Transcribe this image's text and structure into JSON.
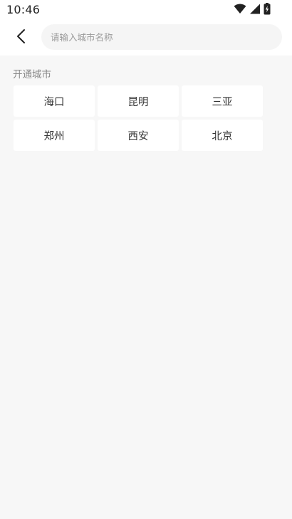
{
  "status_bar": {
    "time": "10:46",
    "icons": [
      "wifi-icon",
      "cell-signal-icon",
      "battery-charging-icon"
    ]
  },
  "header": {
    "back_icon": "chevron-left-icon",
    "search_placeholder": "请输入城市名称",
    "search_value": ""
  },
  "section": {
    "title": "开通城市"
  },
  "cities": [
    "海口",
    "昆明",
    "三亚",
    "郑州",
    "西安",
    "北京"
  ],
  "colors": {
    "page_background": "#f7f7f7",
    "card_background": "#ffffff",
    "search_background": "#f5f5f5",
    "muted_text": "#8a8a8a"
  }
}
